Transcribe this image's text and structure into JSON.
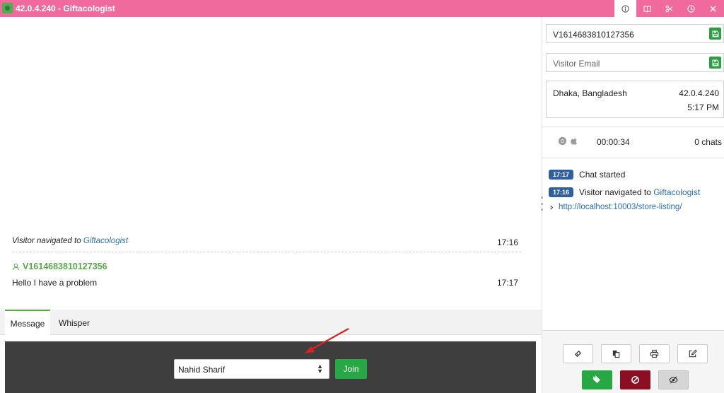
{
  "window": {
    "title": "42.0.4.240 - Giftacologist",
    "accent_color": "#f06a9e",
    "icons": [
      "info-icon",
      "book-icon",
      "scissors-icon",
      "clock-icon",
      "close-icon"
    ]
  },
  "chat": {
    "system_message": {
      "prefix": "Visitor navigated to",
      "link": "Giftacologist",
      "time": "17:16"
    },
    "message": {
      "sender": "V1614683810127356",
      "text": "Hello I have a problem",
      "time": "17:17"
    }
  },
  "tabs": [
    {
      "label": "Message",
      "active": true
    },
    {
      "label": "Whisper",
      "active": false
    }
  ],
  "join": {
    "selected_agent": "Nahid Sharif",
    "join_label": "Join"
  },
  "sidebar": {
    "visitor_id": "V1614683810127356",
    "email_placeholder": "Visitor Email",
    "location": "Dhaka, Bangladesh",
    "ip": "42.0.4.240",
    "local_time": "5:17 PM",
    "browser_icons": [
      "chrome-icon",
      "apple-icon"
    ],
    "duration": "00:00:34",
    "chats_count": "0 chats",
    "events": [
      {
        "time": "17:17",
        "text": "Chat started",
        "link": ""
      },
      {
        "time": "17:16",
        "text": "Visitor navigated to",
        "link": "Giftacologist"
      }
    ],
    "url": "http://localhost:10003/store-listing/"
  },
  "actions": {
    "row1": [
      "ticket-icon",
      "copy-icon",
      "print-icon",
      "edit-icon"
    ],
    "row2": [
      "tag-icon",
      "ban-icon",
      "eye-slash-icon"
    ],
    "colors": {
      "tag": "#28a745",
      "ban": "#8b0e22",
      "hide": "#d5d5d5"
    }
  }
}
